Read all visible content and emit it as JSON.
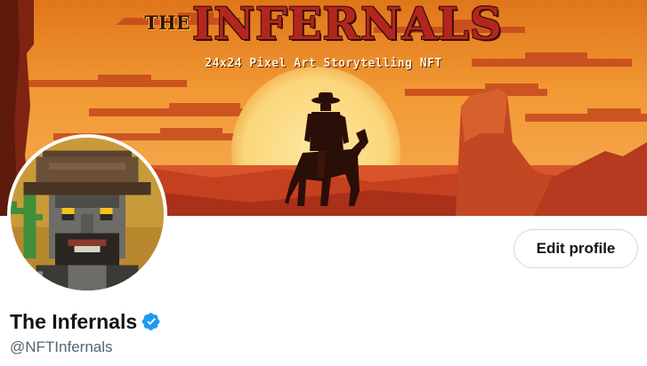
{
  "banner": {
    "title_prefix": "THE",
    "title_main": "INFERNALS",
    "tagline": "24x24 Pixel Art Storytelling NFT"
  },
  "profile": {
    "display_name": "The Infernals",
    "handle": "@NFTInfernals",
    "verified": true,
    "edit_button_label": "Edit profile"
  },
  "colors": {
    "verified_badge": "#1d9bf0",
    "name_text": "#0f1419",
    "handle_text": "#536471",
    "banner_sky_top": "#e8871f",
    "banner_sun": "#fbd67a"
  },
  "icons": {
    "verified": "verified-badge-icon"
  }
}
